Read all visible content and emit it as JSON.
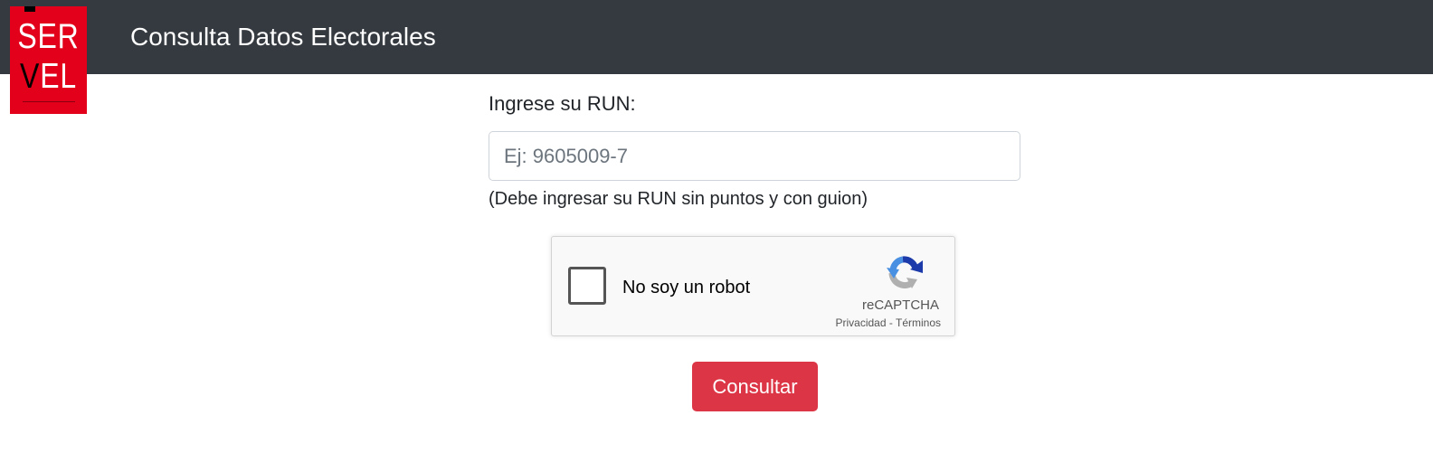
{
  "header": {
    "logo": {
      "line1": "SER",
      "line2_v": "V",
      "line2_el": "EL"
    },
    "title": "Consulta Datos Electorales"
  },
  "form": {
    "run_label": "Ingrese su RUN:",
    "run_input": {
      "value": "",
      "placeholder": "Ej: 9605009-7"
    },
    "run_help": "(Debe ingresar su RUN sin puntos y con guion)",
    "recaptcha": {
      "checked": false,
      "label": "No soy un robot",
      "brand": "reCAPTCHA",
      "privacy_link": "Privacidad",
      "separator": " - ",
      "terms_link": "Términos",
      "icon": "recaptcha-logo-icon"
    },
    "submit_label": "Consultar"
  },
  "colors": {
    "navbar": "#343a40",
    "logo_red": "#e2001a",
    "button_red": "#dc3545",
    "recaptcha_blue": "#1c3aa9",
    "recaptcha_light_blue": "#4a90e2",
    "recaptcha_gray": "#b0b0b0"
  }
}
